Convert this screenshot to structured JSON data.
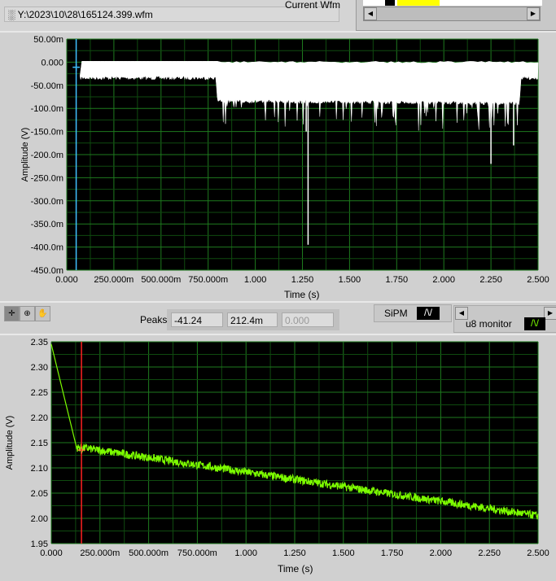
{
  "header": {
    "file_path": "Y:\\2023\\10\\28\\165124.399.wfm",
    "current_wfm_label": "Current Wfm"
  },
  "controls": {
    "peaks_label": "Peaks",
    "peaks_values": [
      "-41.24",
      "212.4m",
      "0.000"
    ],
    "sipm_label": "SiPM",
    "monitor_label": "u8 monitor"
  },
  "colors": {
    "plot_bg": "#000000",
    "grid": "#1e7a1e",
    "top_trace": "#ffffff",
    "bottom_trace": "#7cfc00",
    "cursor_top": "#40c0ff",
    "cursor_bottom": "#ff2020"
  },
  "chart_data": [
    {
      "type": "line",
      "title": "",
      "xlabel": "Time (s)",
      "ylabel": "Amplitude (V)",
      "xlim": [
        0,
        2.5
      ],
      "ylim": [
        -0.45,
        0.05
      ],
      "xticks": [
        "0.000",
        "250.000m",
        "500.000m",
        "750.000m",
        "1.000",
        "1.250",
        "1.500",
        "1.750",
        "2.000",
        "2.250",
        "2.500"
      ],
      "yticks": [
        "50.00m",
        "0.000",
        "-50.00m",
        "-100.0m",
        "-150.0m",
        "-200.0m",
        "-250.0m",
        "-300.0m",
        "-350.0m",
        "-400.0m",
        "-450.0m"
      ],
      "envelope": {
        "x": [
          0,
          0.79,
          0.8,
          2.4,
          2.41,
          2.5
        ],
        "upper": [
          0.0,
          0.0,
          0.0,
          0.0,
          0.0,
          0.0
        ],
        "lower": [
          -0.03,
          -0.03,
          -0.08,
          -0.085,
          -0.03,
          -0.03
        ]
      },
      "spikes": [
        {
          "x": 1.28,
          "y": -0.395
        },
        {
          "x": 2.25,
          "y": -0.22
        },
        {
          "x": 2.37,
          "y": -0.18
        },
        {
          "x": 1.27,
          "y": -0.15
        }
      ],
      "cursor_x": 0.05,
      "grid": true
    },
    {
      "type": "line",
      "title": "",
      "xlabel": "Time (s)",
      "ylabel": "Amplitude (V)",
      "xlim": [
        0,
        2.5
      ],
      "ylim": [
        1.95,
        2.35
      ],
      "xticks": [
        "0.000",
        "250.000m",
        "500.000m",
        "750.000m",
        "1.000",
        "1.250",
        "1.500",
        "1.750",
        "2.000",
        "2.250",
        "2.500"
      ],
      "yticks": [
        "2.35",
        "2.30",
        "2.25",
        "2.20",
        "2.15",
        "2.10",
        "2.05",
        "2.00",
        "1.95"
      ],
      "x": [
        0,
        0.13,
        0.16,
        2.5
      ],
      "y": [
        2.345,
        2.14,
        2.14,
        2.005
      ],
      "noise": 0.008,
      "cursor_x": 0.155,
      "grid": true
    }
  ]
}
